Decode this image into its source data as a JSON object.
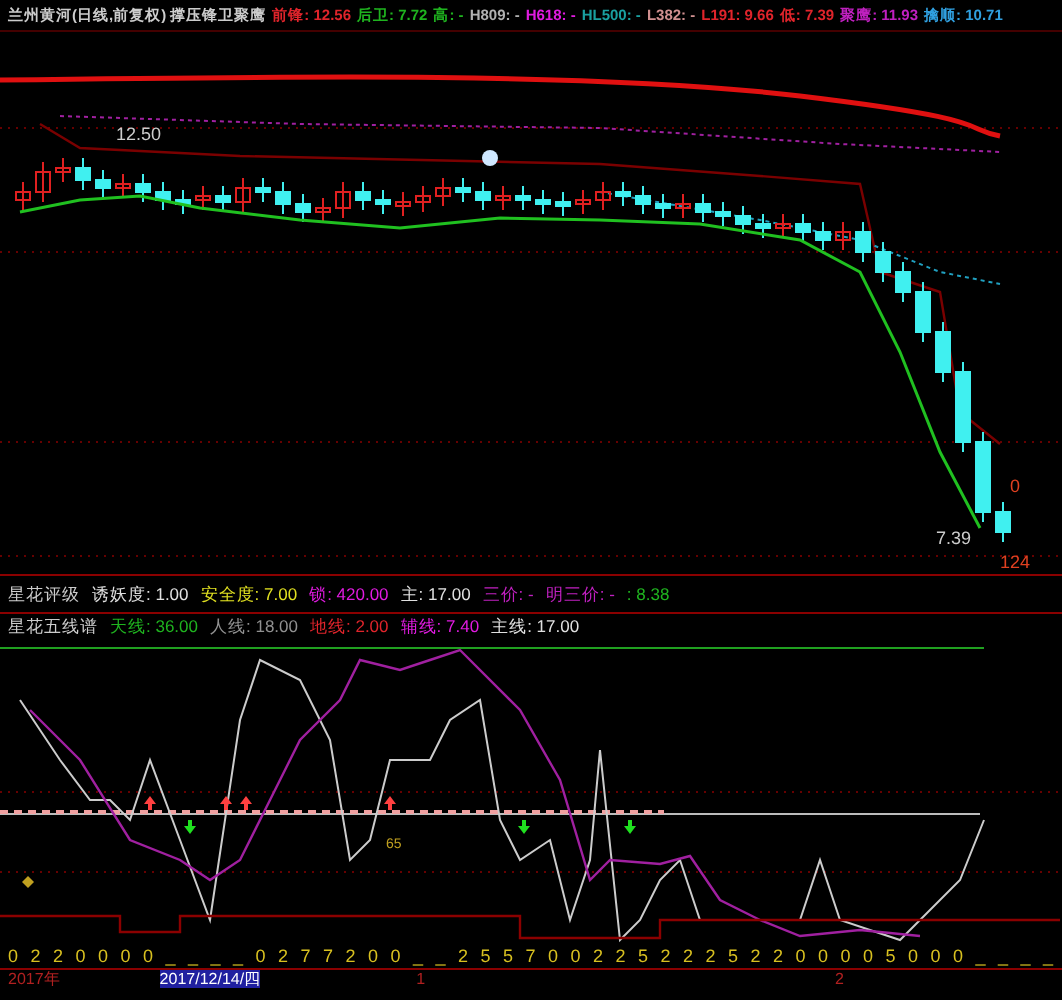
{
  "header": {
    "title": "兰州黄河(日线,前复权) 撑压锋卫聚鹰",
    "indicators": [
      {
        "text": "前锋: 12.56",
        "color": "#e0242b"
      },
      {
        "text": "后卫: 7.72",
        "color": "#1fb31f"
      },
      {
        "text": "高: -",
        "color": "#1fb31f"
      },
      {
        "text": "H809: -",
        "color": "#b0b0b0"
      },
      {
        "text": "H618: -",
        "color": "#e01be0"
      },
      {
        "text": "HL500: -",
        "color": "#1aa0a0"
      },
      {
        "text": "L382: -",
        "color": "#d09090"
      },
      {
        "text": "L191: 9.66",
        "color": "#e0242b"
      },
      {
        "text": "低: 7.39",
        "color": "#e0242b"
      },
      {
        "text": "聚鹰: 11.93",
        "color": "#c020c0"
      },
      {
        "text": "擒顺: 10.71",
        "color": "#30a0e0"
      }
    ]
  },
  "main_chart": {
    "high_label": "12.50",
    "low_label": "7.39",
    "peak_label": "0",
    "count_label": "124"
  },
  "rating_bar": {
    "title": "星花评级",
    "items": [
      {
        "text": "诱妖度: 1.00",
        "color": "#e0e0e0"
      },
      {
        "text": "安全度: 7.00",
        "color": "#e0e020"
      },
      {
        "text": "锁: 420.00",
        "color": "#e01be0"
      },
      {
        "text": "主: 17.00",
        "color": "#e0e0e0"
      },
      {
        "text": "三价: -",
        "color": "#c020c0"
      },
      {
        "text": "明三价: -",
        "color": "#c020c0"
      },
      {
        "text": ": 8.38",
        "color": "#1fb31f"
      }
    ]
  },
  "staff_bar": {
    "title": "星花五线谱",
    "items": [
      {
        "text": "天线: 36.00",
        "color": "#1fb31f"
      },
      {
        "text": "人线: 18.00",
        "color": "#909090"
      },
      {
        "text": "地线: 2.00",
        "color": "#e0242b"
      },
      {
        "text": "辅线: 7.40",
        "color": "#e01be0"
      },
      {
        "text": "主线: 17.00",
        "color": "#e0e0e0"
      }
    ]
  },
  "lower_chart": {
    "marker_label": "65"
  },
  "digits": [
    "0",
    "2",
    "2",
    "0",
    "0",
    "0",
    "0",
    "_",
    "_",
    "_",
    "_",
    "0",
    "2",
    "7",
    "7",
    "2",
    "0",
    "0",
    "_",
    "_",
    "2",
    "5",
    "5",
    "7",
    "0",
    "0",
    "2",
    "2",
    "5",
    "2",
    "2",
    "2",
    "5",
    "2",
    "2",
    "0",
    "0",
    "0",
    "0",
    "5",
    "0",
    "0",
    "0",
    "_",
    "_",
    "_",
    "_"
  ],
  "date_axis": [
    {
      "label": "2017年",
      "selected": false
    },
    {
      "label": "2017/12/14/四",
      "selected": true
    },
    {
      "label": "1",
      "selected": false
    },
    {
      "label": "2",
      "selected": false
    }
  ]
}
